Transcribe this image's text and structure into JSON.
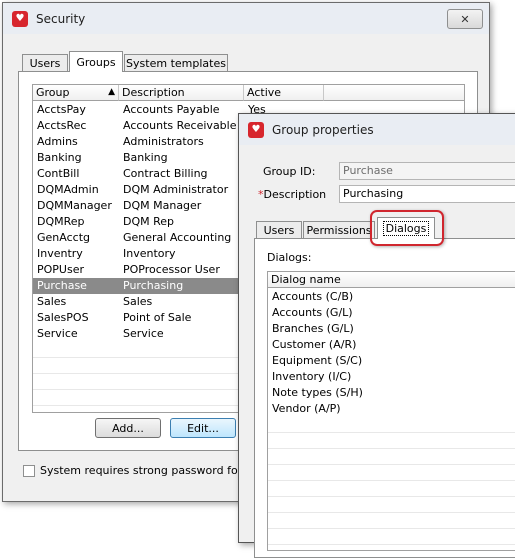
{
  "security": {
    "title": "Security",
    "close_glyph": "✕",
    "tabs": [
      "Users",
      "Groups",
      "System templates"
    ],
    "columns": [
      "Group",
      "Description",
      "Active"
    ],
    "rows": [
      {
        "group": "AcctsPay",
        "description": "Accounts Payable",
        "active": "Yes"
      },
      {
        "group": "AcctsRec",
        "description": "Accounts Receivable",
        "active": ""
      },
      {
        "group": "Admins",
        "description": "Administrators",
        "active": ""
      },
      {
        "group": "Banking",
        "description": "Banking",
        "active": ""
      },
      {
        "group": "ContBill",
        "description": "Contract Billing",
        "active": ""
      },
      {
        "group": "DQMAdmin",
        "description": "DQM Administrator",
        "active": ""
      },
      {
        "group": "DQMManager",
        "description": "DQM Manager",
        "active": ""
      },
      {
        "group": "DQMRep",
        "description": "DQM Rep",
        "active": ""
      },
      {
        "group": "GenAcctg",
        "description": "General Accounting",
        "active": ""
      },
      {
        "group": "Inventry",
        "description": "Inventory",
        "active": ""
      },
      {
        "group": "POPUser",
        "description": "POProcessor User",
        "active": ""
      },
      {
        "group": "Purchase",
        "description": "Purchasing",
        "active": ""
      },
      {
        "group": "Sales",
        "description": "Sales",
        "active": ""
      },
      {
        "group": "SalesPOS",
        "description": "Point of Sale",
        "active": ""
      },
      {
        "group": "Service",
        "description": "Service",
        "active": ""
      }
    ],
    "selected_group": "Purchase",
    "add_label": "Add...",
    "edit_label": "Edit...",
    "strong_password_label": "System requires strong password for all"
  },
  "group_properties": {
    "title": "Group properties",
    "group_id_label": "Group ID:",
    "group_id_value": "Purchase",
    "required_marker": "*",
    "description_label": "Description",
    "description_value": "Purchasing",
    "tabs": [
      "Users",
      "Permissions",
      "Dialogs"
    ],
    "dialogs_label": "Dialogs:",
    "dialog_column": "Dialog name",
    "dialogs": [
      "Accounts (C/B)",
      "Accounts (G/L)",
      "Branches (G/L)",
      "Customer (A/R)",
      "Equipment (S/C)",
      "Inventory (I/C)",
      "Note types (S/H)",
      "Vendor (A/P)"
    ]
  },
  "colors": {
    "highlight": "#d0262e",
    "selected_row": "#8a8a8a",
    "app_icon": "#d7262e"
  }
}
